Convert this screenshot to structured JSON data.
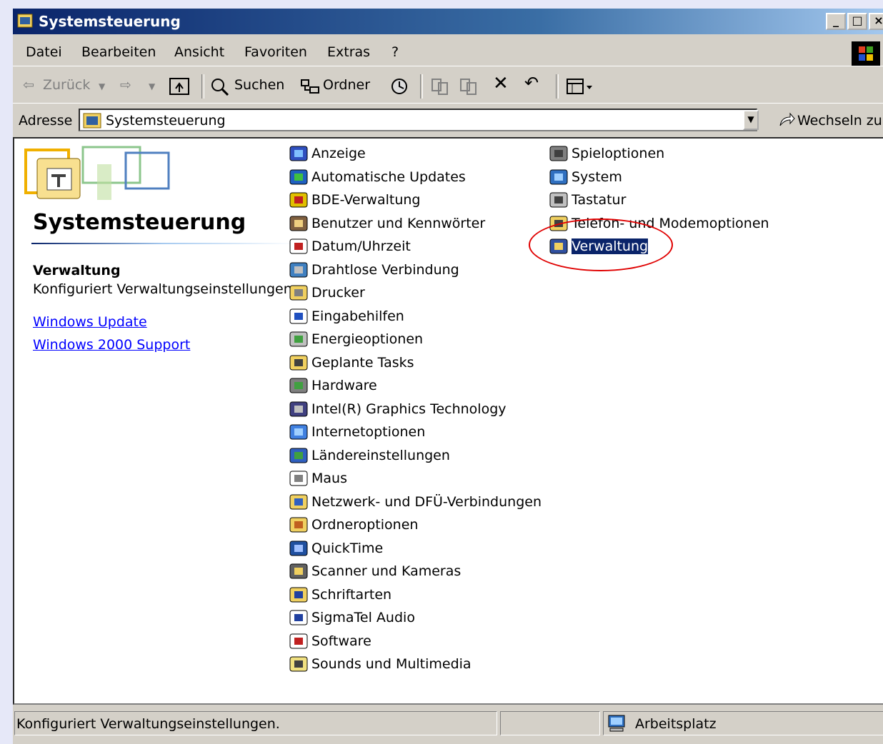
{
  "window": {
    "title": "Systemsteuerung",
    "buttons": {
      "minimize": "_",
      "maximize": "□",
      "close": "×"
    }
  },
  "menubar": {
    "items": [
      "Datei",
      "Bearbeiten",
      "Ansicht",
      "Favoriten",
      "Extras",
      "?"
    ]
  },
  "toolbar": {
    "back_label": "Zurück",
    "search_label": "Suchen",
    "folders_label": "Ordner"
  },
  "address": {
    "label": "Adresse",
    "value": "Systemsteuerung",
    "go_label": "Wechseln zu"
  },
  "sidebar": {
    "title": "Systemsteuerung",
    "selected_title": "Verwaltung",
    "selected_desc": "Konfiguriert Verwaltungseinstellungen.",
    "links": [
      "Windows Update",
      "Windows 2000 Support"
    ]
  },
  "items": {
    "col1": [
      {
        "label": "Anzeige",
        "icon": "display-icon"
      },
      {
        "label": "Automatische Updates",
        "icon": "windows-update-icon"
      },
      {
        "label": "BDE-Verwaltung",
        "icon": "bde-icon"
      },
      {
        "label": "Benutzer und Kennwörter",
        "icon": "users-icon"
      },
      {
        "label": "Datum/Uhrzeit",
        "icon": "clock-icon"
      },
      {
        "label": "Drahtlose Verbindung",
        "icon": "wireless-icon"
      },
      {
        "label": "Drucker",
        "icon": "printer-icon"
      },
      {
        "label": "Eingabehilfen",
        "icon": "accessibility-icon"
      },
      {
        "label": "Energieoptionen",
        "icon": "power-icon"
      },
      {
        "label": "Geplante Tasks",
        "icon": "tasks-icon"
      },
      {
        "label": "Hardware",
        "icon": "hardware-icon"
      },
      {
        "label": "Intel(R) Graphics Technology",
        "icon": "intel-graphics-icon"
      },
      {
        "label": "Internetoptionen",
        "icon": "internet-icon"
      },
      {
        "label": "Ländereinstellungen",
        "icon": "globe-icon"
      },
      {
        "label": "Maus",
        "icon": "mouse-icon"
      },
      {
        "label": "Netzwerk- und DFÜ-Verbindungen",
        "icon": "network-icon"
      },
      {
        "label": "Ordneroptionen",
        "icon": "folder-options-icon"
      },
      {
        "label": "QuickTime",
        "icon": "quicktime-icon"
      },
      {
        "label": "Scanner und Kameras",
        "icon": "scanner-icon"
      },
      {
        "label": "Schriftarten",
        "icon": "fonts-icon"
      },
      {
        "label": "SigmaTel Audio",
        "icon": "audio-icon"
      },
      {
        "label": "Software",
        "icon": "software-icon"
      },
      {
        "label": "Sounds und Multimedia",
        "icon": "speaker-icon"
      }
    ],
    "col2": [
      {
        "label": "Spieloptionen",
        "icon": "joystick-icon"
      },
      {
        "label": "System",
        "icon": "computer-icon"
      },
      {
        "label": "Tastatur",
        "icon": "keyboard-icon"
      },
      {
        "label": "Telefon- und Modemoptionen",
        "icon": "phone-icon"
      },
      {
        "label": "Verwaltung",
        "icon": "admin-tools-icon",
        "selected": true
      }
    ]
  },
  "statusbar": {
    "text": "Konfiguriert Verwaltungseinstellungen.",
    "zone": "Arbeitsplatz"
  },
  "colors": {
    "title_gradient_start": "#0a246a",
    "selection": "#0a246a",
    "link": "#0000ff",
    "annotation_ellipse": "#e00000",
    "background": "#e6e8f8"
  }
}
